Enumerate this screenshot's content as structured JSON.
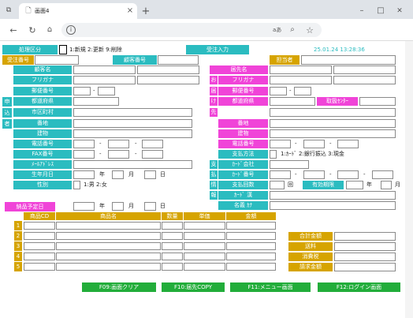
{
  "browser": {
    "tab_title": "画面4",
    "address": "",
    "controls": {
      "minimize": "–",
      "maximize": "□",
      "close": "✕"
    },
    "new_tab": "+",
    "tab_close": "×",
    "reader_label": "aあ"
  },
  "header": {
    "kbn_label": "処理区分",
    "kbn_hint": "1:新規 2:更新 9:削除",
    "mode_label": "受注入力",
    "datetime": "25.01.24 13:28:36",
    "juchu_no_label": "受注番号",
    "kokyaku_no_label": "顧客番号",
    "tantou_label": "担当者"
  },
  "customer": {
    "name_label": "顧客名",
    "kana_label": "フリガナ",
    "zip_label": "郵便番号",
    "zip_sep": "-",
    "pref_label": "都道府県",
    "city_label": "市区町村",
    "street_label": "番地",
    "bldg_label": "建物",
    "tel_label": "電話番号",
    "fax_label": "FAX番号",
    "mail_label": "ﾒｰﾙｱﾄﾞﾚｽ",
    "birth_label": "生年月日",
    "nen": "年",
    "tsuki": "月",
    "hi": "日",
    "sex_label": "性別",
    "sex_hint": "1:男 2:女",
    "side_chars": [
      "申",
      "込",
      "者"
    ]
  },
  "delivery": {
    "name_label": "届先名",
    "kana_label": "フリガナ",
    "zip_label": "郵便番号",
    "pref_label": "都道府県",
    "center_label": "取扱ｾﾝﾀｰ",
    "street_label": "番地",
    "bldg_label": "建物",
    "tel_label": "電話番号",
    "side_chars": [
      "お",
      "届",
      "け",
      "先"
    ],
    "pay_label": "支払方法",
    "pay_hint": "1:ｶｰﾄﾞ 2:銀行振込 3:現金",
    "card_co_label": "ｶｰﾄﾞ会社",
    "card_no_label": "ｶｰﾄﾞ番号",
    "count_label": "支払回数",
    "kai": "回",
    "expiry_label": "有効期限",
    "nen": "年",
    "tsuki": "月",
    "card_name_label": "ｶｰﾄﾞ 漢",
    "meigi_label": "名義 ｶﾅ",
    "side2_chars": [
      "支",
      "払",
      "情",
      "報"
    ]
  },
  "delivery_date_label": "納品予定日",
  "orders": {
    "headers": {
      "code": "商品CD",
      "name": "商品名",
      "qty": "数量",
      "price": "単価",
      "amount": "金額"
    },
    "rows": [
      "1",
      "2",
      "3",
      "4",
      "5"
    ]
  },
  "totals": {
    "goukei": "合計金額",
    "souryou": "送料",
    "shouhizei": "消費税",
    "seikyu": "請求金額"
  },
  "fkeys": [
    "F09:画面クリア",
    "F10:届先COPY",
    "F11:メニュー画面",
    "F12:ログイン画面"
  ]
}
